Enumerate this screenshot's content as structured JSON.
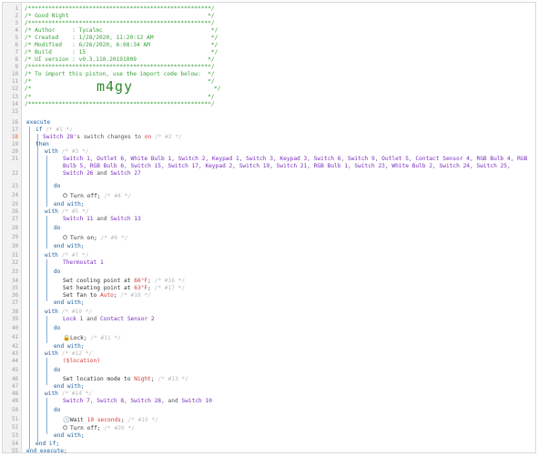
{
  "line_numbers": [
    "1",
    "2",
    "3",
    "4",
    "5",
    "6",
    "7",
    "8",
    "9",
    "10",
    "11",
    "12",
    "13",
    "14",
    "15",
    "16",
    "17",
    "18",
    "19",
    "20",
    "21",
    "",
    "22",
    "23",
    "24",
    "25",
    "26",
    "27",
    "28",
    "29",
    "30",
    "31",
    "32",
    "33",
    "34",
    "35",
    "36",
    "37",
    "38",
    "39",
    "40",
    "41",
    "42",
    "43",
    "44",
    "45",
    "46",
    "47",
    "48",
    "49",
    "50",
    "51",
    "52",
    "53",
    "54",
    "55",
    "56"
  ],
  "header": {
    "l1": "/******************************************************/",
    "l2": "/* Good Night                                         */",
    "l3": "/******************************************************/",
    "l4": "/* Author     : Tycalmc                                */",
    "l5": "/* Created    : 1/28/2020, 11:20:12 AM                 */",
    "l6": "/* Modified   : 6/26/2020, 6:08:34 AM                  */",
    "l7": "/* Build      : 15                                     */",
    "l8": "/* UI version : v0.3.110.20191009                     */",
    "l9": "/******************************************************/",
    "l10": "/* To import this piston, use the import code below:  */",
    "l11": "/*                                                    */",
    "l12_pre": "/*",
    "l12_code": "m4gy",
    "l12_post": "*/",
    "l13": "/*                                                    */",
    "l14": "/******************************************************/"
  },
  "code": {
    "execute": "execute",
    "if": "if",
    "if_cm": "/* #1 */",
    "if_cond_dev": "Switch 28",
    "if_cond_rest": "'s switch changes to",
    "if_cond_val": "on",
    "if_cond_cm": "/* #2 */",
    "then": "then",
    "with": "with",
    "do": "do",
    "end_with": "end with;",
    "w1_cm": "/* #3 */",
    "w1_dev_l1": "Switch 1, Outlet 6, White Bulb 1, Switch 2, Keypad 1, Switch 3, Keypad 3, Switch 6, Switch 9, Outlet 5, Contact Sensor 4, RGB Bulb 4, RGB",
    "w1_dev_l2": "Bulb 5, RGB Bulb 6, Switch 15, Switch 17, Keypad 2, Switch 19, Switch 21, RGB Bulb 1, Switch 23, White Bulb 2, Switch 24, Switch 25,",
    "w1_dev_l3a": "Switch 26",
    "w1_dev_l3b": "and",
    "w1_dev_l3c": "Switch 27",
    "turn_off": "Turn off;",
    "turn_off_cm1": "/* #4 */",
    "w2_cm": "/* #5 */",
    "w2_dev_a": "Switch 11",
    "w2_and": "and",
    "w2_dev_b": "Switch 13",
    "turn_on": "Turn on;",
    "turn_on_cm": "/* #6 */",
    "w3_cm": "/* #7 */",
    "w3_dev": "Thermostat 1",
    "cool_a": "Set cooling point at",
    "cool_v": "66°F",
    "cool_cm": "/* #16 */",
    "heat_a": "Set heating point at",
    "heat_v": "63°F",
    "heat_cm": "/* #17 */",
    "fan_a": "Set fan to",
    "fan_v": "Auto",
    "fan_cm": "/* #18 */",
    "w4_cm": "/* #10 */",
    "w4_dev_a": "Lock 1",
    "w4_and": "and",
    "w4_dev_b": "Contact Sensor 2",
    "lock": "Lock;",
    "lock_cm": "/* #11 */",
    "w5_cm": "/* #12 */",
    "w5_dev": "($location)",
    "loc_a": "Set location mode to",
    "loc_v": "Night",
    "loc_cm": "/* #13 */",
    "w6_cm": "/* #14 */",
    "w6_dev_a": "Switch 7, Switch 8, Switch 28,",
    "w6_and": "and",
    "w6_dev_b": "Switch 10",
    "wait_a": "Wait",
    "wait_v": "10 seconds",
    "wait_cm": "/* #19 */",
    "off2_cm": "/* #20 */",
    "end_if": "end if;",
    "end_execute": "end execute;"
  },
  "icons": {
    "power": "power-icon",
    "lock": "lock-icon",
    "clock": "clock-icon"
  },
  "colors": {
    "comment_green": "#39a239",
    "comment_grey": "#b8b8b8",
    "keyword_blue": "#1a5fa0",
    "device_purple": "#7a2dbd",
    "value_red": "#d23c3c",
    "trigger_marker": "#e0632e"
  }
}
